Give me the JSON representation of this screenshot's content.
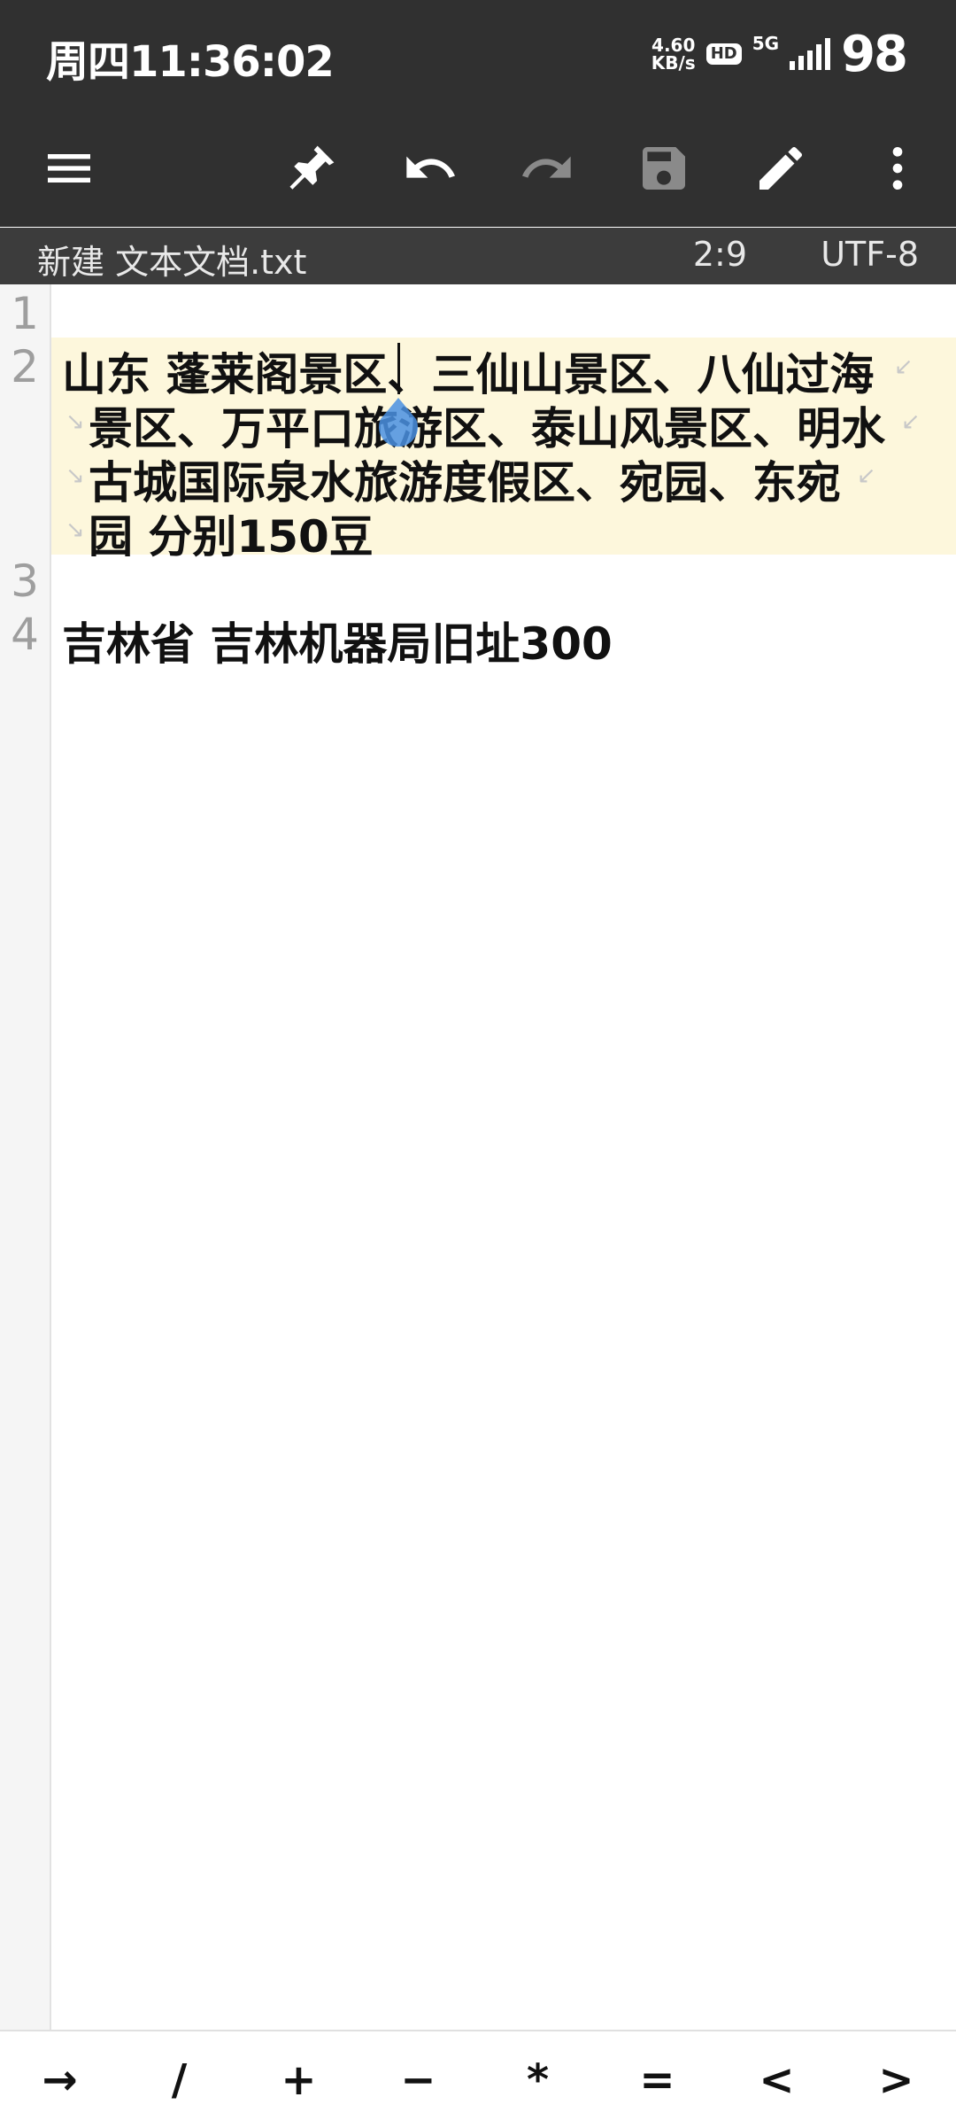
{
  "status_bar": {
    "time": "周四11:36:02",
    "net_speed_value": "4.60",
    "net_speed_unit": "KB/s",
    "hd_badge": "HD",
    "network": "5G",
    "battery": "98"
  },
  "toolbar": {
    "icons": [
      "menu-icon",
      "pin-icon",
      "undo-icon",
      "redo-icon",
      "save-icon",
      "edit-icon",
      "more-icon"
    ]
  },
  "file": {
    "name": "新建 文本文档.txt",
    "cursor_position": "2:9",
    "encoding": "UTF-8"
  },
  "editor": {
    "line_numbers": [
      "1",
      "2",
      "3",
      "4"
    ],
    "line2_row1": "山东 蓬莱阁景区、三仙山景区、八仙过海",
    "line2_row2": "景区、万平口旅游区、泰山风景区、明水",
    "line2_row3": "古城国际泉水旅游度假区、宛园、东宛",
    "line2_row4": "园 分别150豆",
    "line4": "吉林省 吉林机器局旧址300"
  },
  "symbols": [
    "→",
    "/",
    "+",
    "−",
    "*",
    "=",
    "<",
    ">"
  ],
  "colors": {
    "bar_bg": "#303030",
    "file_bar_bg": "#3c3c3c",
    "highlight": "#fdf7dc",
    "handle": "#4a90e2"
  }
}
